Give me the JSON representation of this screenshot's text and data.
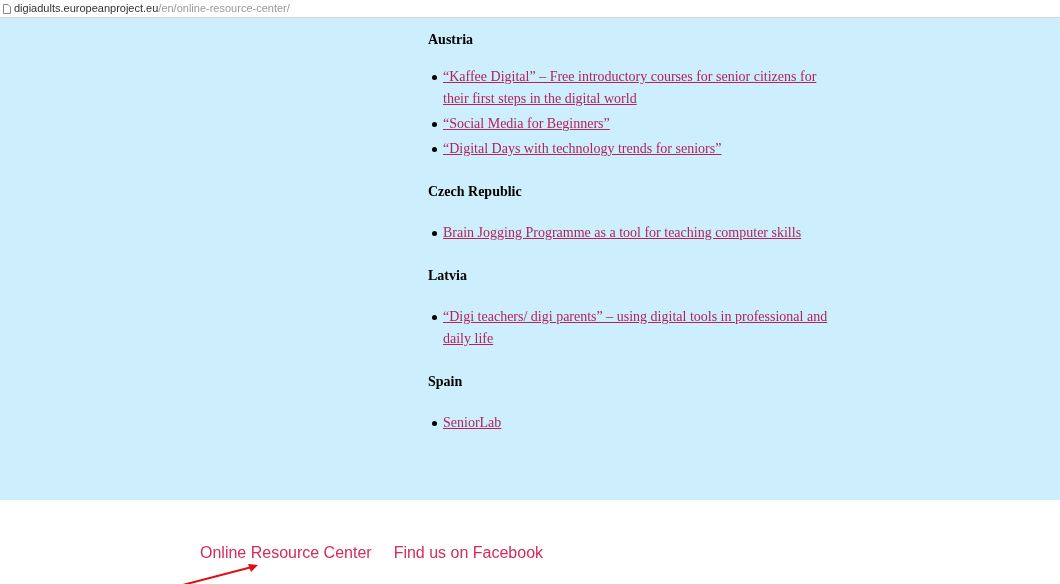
{
  "address_bar": {
    "host": "digiadults.europeanproject.eu",
    "path": "/en/online-resource-center/"
  },
  "sections": [
    {
      "heading": "Austria",
      "links": [
        "“Kaffee Digital” – Free introductory courses for senior citizens for their first steps in the digital world",
        "“Social Media for Beginners”",
        "“Digital Days with technology trends for seniors”"
      ]
    },
    {
      "heading": "Czech Republic",
      "links": [
        "Brain Jogging Programme as a tool for teaching computer skills"
      ]
    },
    {
      "heading": "Latvia",
      "links": [
        "“Digi teachers/ digi parents” – using digital tools in professional and daily life"
      ]
    },
    {
      "heading": "Spain",
      "links": [
        "SeniorLab"
      ]
    }
  ],
  "footer_links": [
    "Online Resource Center",
    "Find us on Facebook"
  ]
}
